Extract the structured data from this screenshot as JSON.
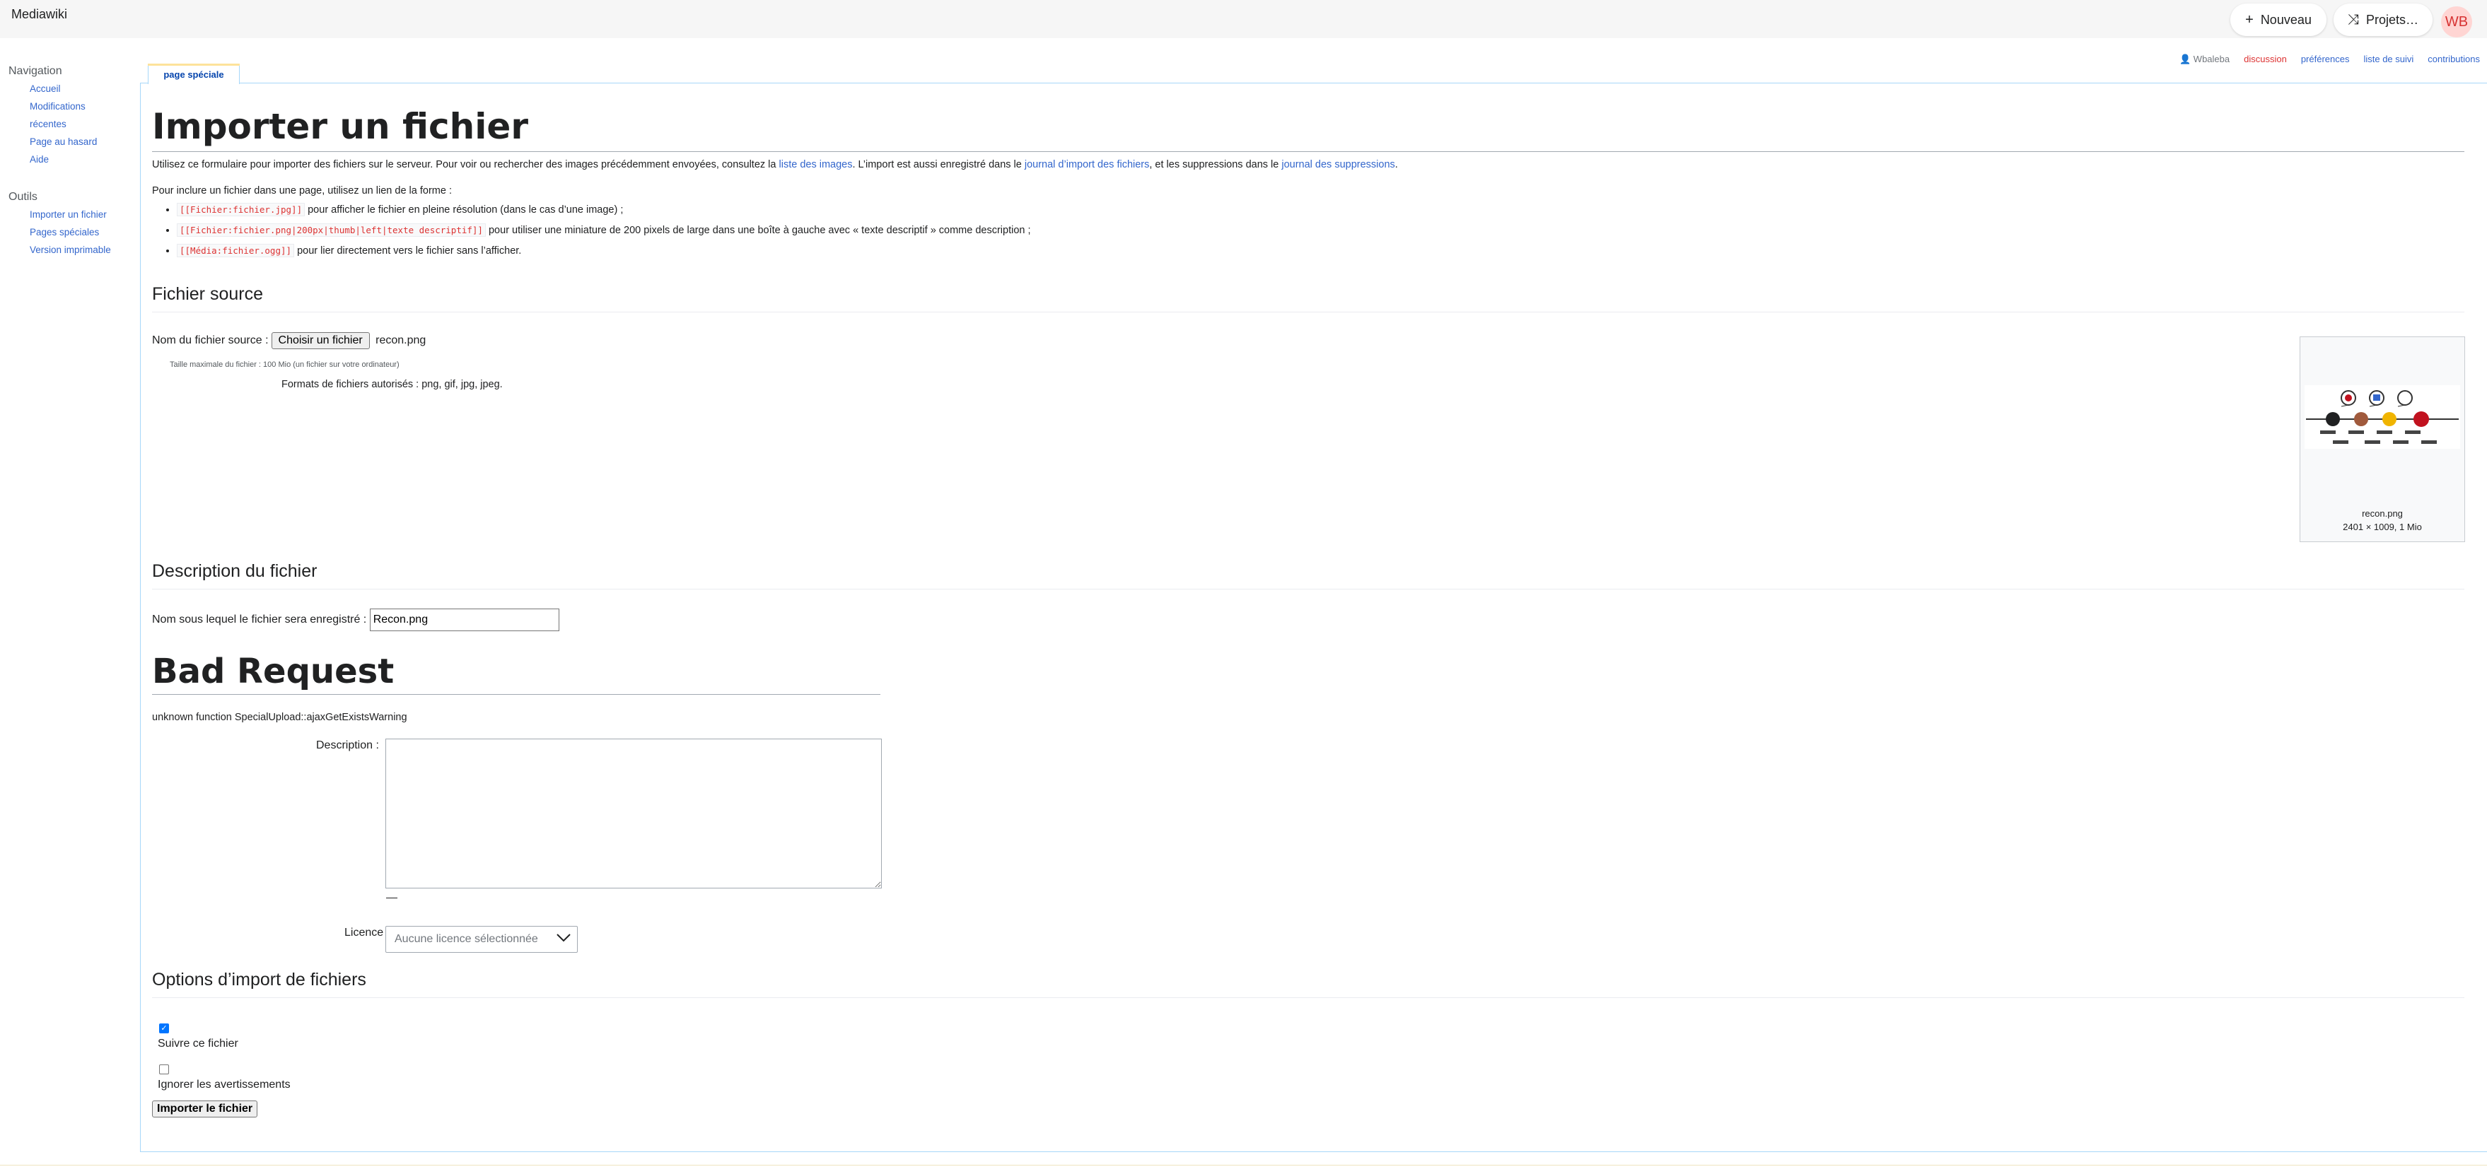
{
  "header": {
    "site_name": "Mediawiki",
    "new_button": "Nouveau",
    "projects_button": "Projets…",
    "avatar_initials": "WB"
  },
  "personal": {
    "user": "Wbaleba",
    "talk": "discussion",
    "preferences": "préférences",
    "watchlist": "liste de suivi",
    "contributions": "contributions"
  },
  "sidebar": {
    "navigation_heading": "Navigation",
    "navigation_items": [
      {
        "label": "Accueil"
      },
      {
        "label": "Modifications"
      },
      {
        "label": "récentes"
      },
      {
        "label": "Page au hasard"
      },
      {
        "label": "Aide"
      }
    ],
    "tools_heading": "Outils",
    "tools_items": [
      {
        "label": "Importer un fichier"
      },
      {
        "label": "Pages spéciales"
      },
      {
        "label": "Version imprimable"
      }
    ]
  },
  "tab": {
    "label": "page spéciale"
  },
  "page": {
    "title": "Importer un fichier",
    "intro": {
      "part1": "Utilisez ce formulaire pour importer des fichiers sur le serveur. Pour voir ou rechercher des images précédemment envoyées, consultez la ",
      "link1": "liste des images",
      "part2": ". L’import est aussi enregistré dans le ",
      "link2": "journal d’import des fichiers",
      "part3": ", et les suppressions dans le ",
      "link3": "journal des suppressions",
      "part4": "."
    },
    "include_text": "Pour inclure un fichier dans une page, utilisez un lien de la forme :",
    "forms": [
      {
        "code": "[[Fichier:fichier.jpg]]",
        "text": " pour afficher le fichier en pleine résolution (dans le cas d’une image) ;"
      },
      {
        "code": "[[Fichier:fichier.png|200px|thumb|left|texte descriptif]]",
        "text": " pour utiliser une miniature de 200 pixels de large dans une boîte à gauche avec « texte descriptif » comme description ;"
      },
      {
        "code": "[[Média:fichier.ogg]]",
        "text": " pour lier directement vers le fichier sans l’afficher."
      }
    ]
  },
  "source": {
    "heading": "Fichier source",
    "label": "Nom du fichier source :",
    "choose_button": "Choisir un fichier",
    "chosen_file": "recon.png",
    "max_size": "Taille maximale du fichier : 100 Mio (un fichier sur votre ordinateur)",
    "formats": "Formats de fichiers autorisés : png, gif, jpg, jpeg."
  },
  "preview": {
    "filename": "recon.png",
    "info": "2401 × 1009, 1 Mio"
  },
  "description": {
    "heading": "Description du fichier",
    "dest_label": "Nom sous lequel le fichier sera enregistré :",
    "dest_value": "Recon.png",
    "error_title": "Bad Request",
    "error_text": "unknown function SpecialUpload::ajaxGetExistsWarning",
    "desc_label": "Description :",
    "desc_value": "",
    "license_label": "Licence",
    "license_placeholder": "Aucune licence sélectionnée"
  },
  "options": {
    "heading": "Options d’import de fichiers",
    "watch_label": "Suivre ce fichier",
    "watch_checked": true,
    "ignore_label": "Ignorer les avertissements",
    "ignore_checked": false,
    "submit": "Importer le fichier"
  },
  "colors": {
    "link": "#3366cc",
    "talk_red": "#dd3333",
    "avatar_bg": "#ffd5d3",
    "tab_accent": "#fde29b"
  }
}
